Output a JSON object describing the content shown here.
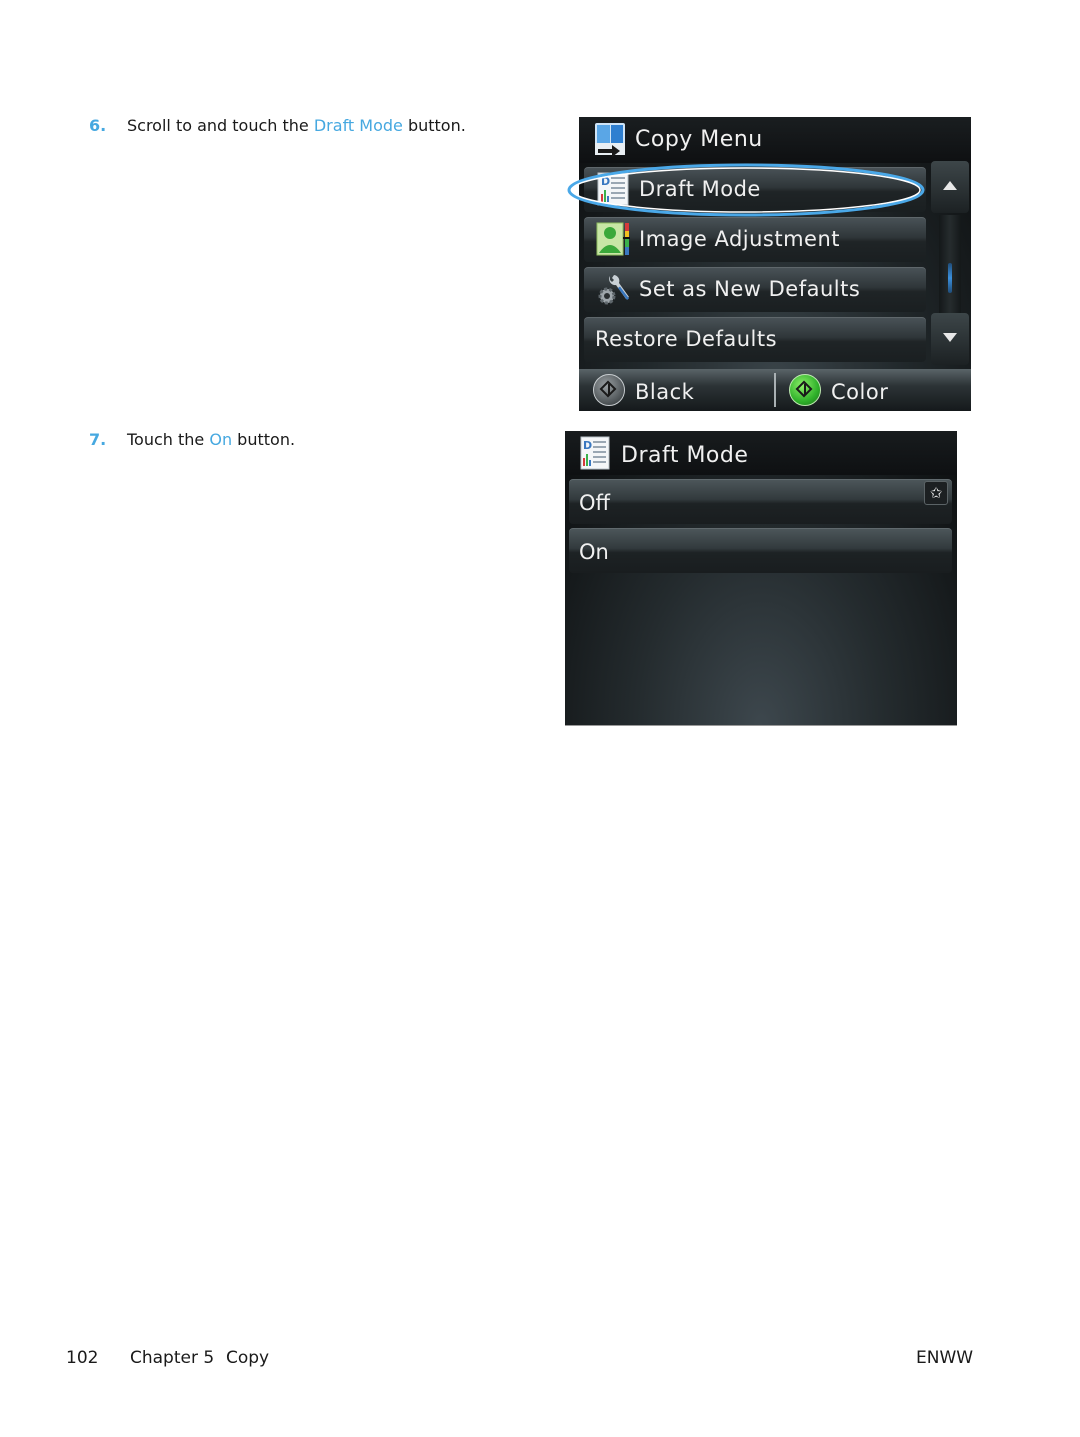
{
  "steps": [
    {
      "number": "6.",
      "text_before": "Scroll to and touch the ",
      "highlight": "Draft Mode",
      "text_after": " button."
    },
    {
      "number": "7.",
      "text_before": "Touch the ",
      "highlight": "On",
      "text_after": " button."
    }
  ],
  "copy_menu_screen": {
    "title": "Copy Menu",
    "title_icon": "copy-icon",
    "items": [
      {
        "label": "Draft Mode",
        "icon": "draft-mode-icon",
        "highlighted": true
      },
      {
        "label": "Image Adjustment",
        "icon": "image-adjustment-icon"
      },
      {
        "label": "Set as New Defaults",
        "icon": "tools-gear-icon"
      },
      {
        "label": "Restore Defaults",
        "icon": null
      }
    ],
    "scroll_up_icon": "arrow-up-icon",
    "scroll_down_icon": "arrow-down-icon",
    "scroll_position": 0.7,
    "start_buttons": [
      {
        "label": "Black",
        "icon": "start-black-icon"
      },
      {
        "label": "Color",
        "icon": "start-color-icon"
      }
    ]
  },
  "draft_mode_screen": {
    "title": "Draft Mode",
    "title_icon": "draft-mode-icon",
    "options": [
      {
        "label": "Off",
        "favorite_icon": "star-icon",
        "favorite_glyph": "✩"
      },
      {
        "label": "On"
      }
    ]
  },
  "footer": {
    "page_number": "102",
    "chapter": "Chapter 5",
    "section": "Copy",
    "right_label": "ENWW"
  },
  "colors": {
    "accent_blue": "#46a8e0",
    "highlight_ring": "#4aa8e8",
    "start_green": "#2fb12a"
  }
}
